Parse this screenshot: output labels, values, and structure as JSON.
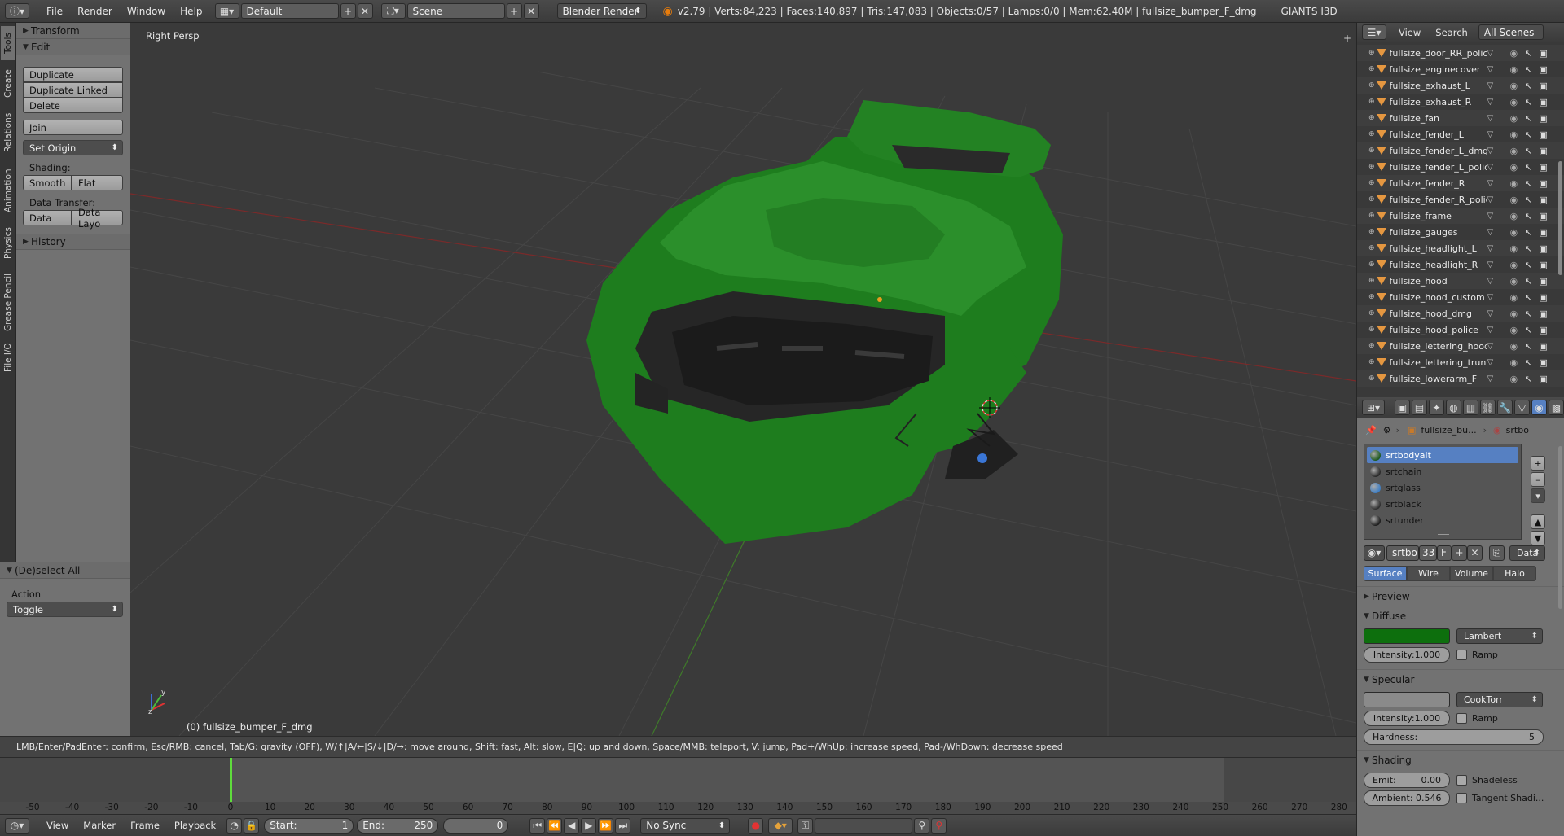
{
  "topbar": {
    "menus": [
      "File",
      "Render",
      "Window",
      "Help"
    ],
    "layout": "Default",
    "scene": "Scene",
    "engine": "Blender Render",
    "info": "v2.79 | Verts:84,223 | Faces:140,897 | Tris:147,083 | Objects:0/57 | Lamps:0/0 | Mem:62.40M | fullsize_bumper_F_dmg",
    "extra": "GIANTS I3D"
  },
  "tabs": [
    "Tools",
    "Create",
    "Relations",
    "Animation",
    "Physics",
    "Grease Pencil",
    "File I/O"
  ],
  "toolshelf": {
    "transform": "Transform",
    "edit": "Edit",
    "duplicate": "Duplicate",
    "duplicate_linked": "Duplicate Linked",
    "delete": "Delete",
    "join": "Join",
    "set_origin": "Set Origin",
    "shading_label": "Shading:",
    "smooth": "Smooth",
    "flat": "Flat",
    "data_transfer_label": "Data Transfer:",
    "data": "Data",
    "data_layout": "Data Layo",
    "history": "History"
  },
  "operator": {
    "title": "(De)select All",
    "action_label": "Action",
    "action_value": "Toggle"
  },
  "viewport": {
    "title": "Right Persp",
    "object": "(0) fullsize_bumper_F_dmg",
    "axis_y": "y",
    "axis_z": "z"
  },
  "status": "LMB/Enter/PadEnter: confirm, Esc/RMB: cancel, Tab/G: gravity (OFF), W/↑|A/←|S/↓|D/→: move around, Shift: fast, Alt: slow, E|Q: up and down, Space/MMB: teleport, V: jump, Pad+/WhUp: increase speed, Pad-/WhDown: decrease speed",
  "timeline": {
    "ticks": [
      "-50",
      "-40",
      "-30",
      "-20",
      "-10",
      "0",
      "10",
      "20",
      "30",
      "40",
      "50",
      "60",
      "70",
      "80",
      "90",
      "100",
      "110",
      "120",
      "130",
      "140",
      "150",
      "160",
      "170",
      "180",
      "190",
      "200",
      "210",
      "220",
      "230",
      "240",
      "250",
      "260",
      "270",
      "280"
    ],
    "menus": [
      "View",
      "Marker",
      "Frame",
      "Playback"
    ],
    "start_label": "Start:",
    "start_value": "1",
    "end_label": "End:",
    "end_value": "250",
    "current": "0",
    "sync": "No Sync"
  },
  "outliner": {
    "view": "View",
    "search": "Search",
    "scenes": "All Scenes",
    "items": [
      "fullsize_door_RR_police",
      "fullsize_enginecover",
      "fullsize_exhaust_L",
      "fullsize_exhaust_R",
      "fullsize_fan",
      "fullsize_fender_L",
      "fullsize_fender_L_dmg",
      "fullsize_fender_L_police",
      "fullsize_fender_R",
      "fullsize_fender_R_police",
      "fullsize_frame",
      "fullsize_gauges",
      "fullsize_headlight_L",
      "fullsize_headlight_R",
      "fullsize_hood",
      "fullsize_hood_custom",
      "fullsize_hood_dmg",
      "fullsize_hood_police",
      "fullsize_lettering_hood",
      "fullsize_lettering_trunk",
      "fullsize_lowerarm_F"
    ]
  },
  "properties": {
    "breadcrumb_object": "fullsize_bu...",
    "breadcrumb_material": "srtbo",
    "materials": [
      "srtbodyalt",
      "srtchain",
      "srtglass",
      "srtblack",
      "srtunder"
    ],
    "material_name": "srtbo",
    "users": "33",
    "fake": "F",
    "data_dropdown": "Data",
    "tabs": [
      "Surface",
      "Wire",
      "Volume",
      "Halo"
    ],
    "preview": "Preview",
    "diffuse": "Diffuse",
    "diffuse_shader": "Lambert",
    "diffuse_intensity": "Intensity:1.000",
    "ramp": "Ramp",
    "specular": "Specular",
    "specular_shader": "CookTorr",
    "specular_intensity": "Intensity:1.000",
    "hardness_label": "Hardness:",
    "hardness_value": "5",
    "shading": "Shading",
    "emit_label": "Emit:",
    "emit_value": "0.00",
    "shadeless": "Shadeless",
    "ambient": "Ambient: 0.546",
    "tangent": "Tangent Shadi...",
    "colors": {
      "diffuse": "#0d6f0d",
      "specular": "#8a8a8a",
      "selected": "#5680c2",
      "model_green": "#1e8a1e"
    }
  }
}
